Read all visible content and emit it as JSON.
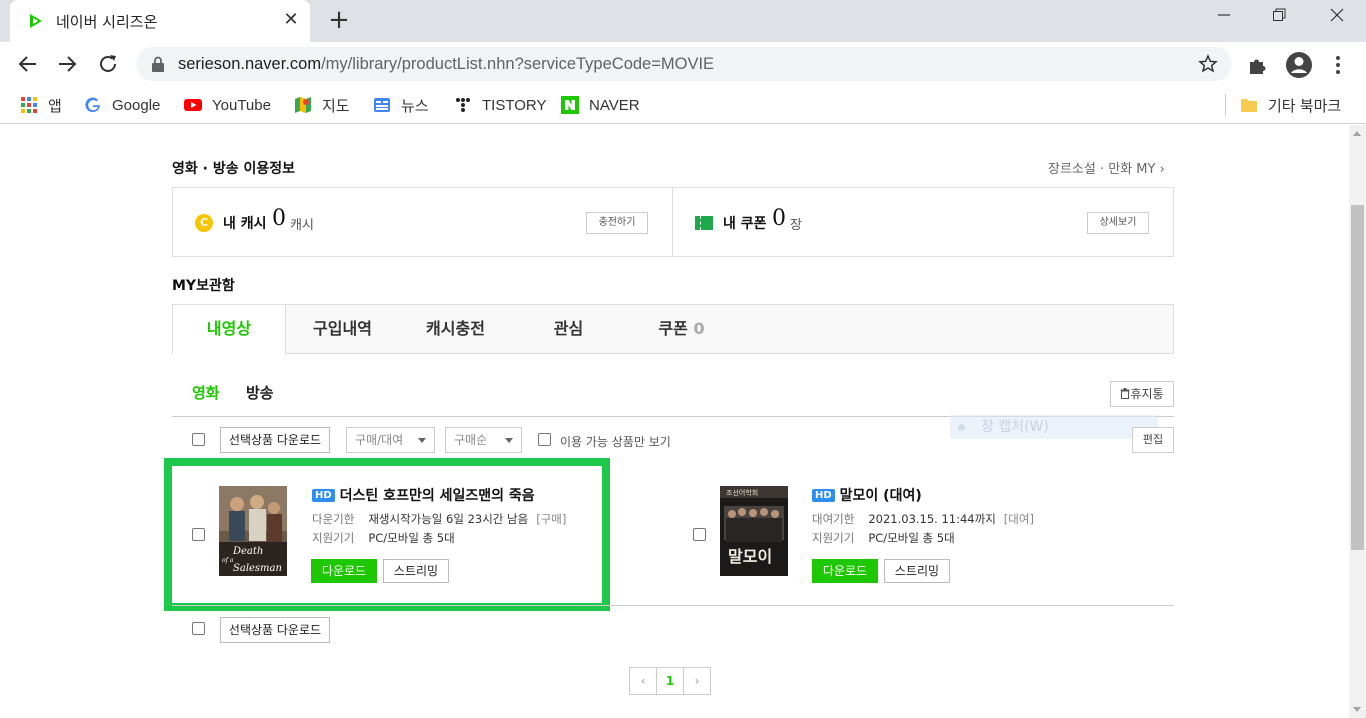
{
  "browser": {
    "tab_title": "네이버 시리즈온",
    "url_host": "serieson.naver.com",
    "url_path": "/my/library/productList.nhn?serviceTypeCode=MOVIE",
    "bookmarks": [
      {
        "label": "앱",
        "icon": "apps-grid-icon"
      },
      {
        "label": "Google",
        "icon": "google-icon"
      },
      {
        "label": "YouTube",
        "icon": "youtube-icon"
      },
      {
        "label": "지도",
        "icon": "maps-icon"
      },
      {
        "label": "뉴스",
        "icon": "news-icon"
      },
      {
        "label": "TISTORY",
        "icon": "tistory-icon"
      },
      {
        "label": "NAVER",
        "icon": "naver-icon"
      }
    ],
    "other_bookmarks": "기타 북마크"
  },
  "info": {
    "section_title": "영화 · 방송 이용정보",
    "genre_link": "장르소설 · 만화 MY",
    "cash_label": "내 캐시",
    "cash_count": "0",
    "cash_unit": "캐시",
    "cash_button": "충전하기",
    "cash_icon_letter": "C",
    "coupon_label": "내 쿠폰",
    "coupon_count": "0",
    "coupon_unit": "장",
    "coupon_button": "상세보기"
  },
  "library": {
    "title": "MY보관함",
    "tabs": [
      {
        "label": "내영상",
        "count": ""
      },
      {
        "label": "구입내역",
        "count": ""
      },
      {
        "label": "캐시충전",
        "count": ""
      },
      {
        "label": "관심",
        "count": ""
      },
      {
        "label": "쿠폰",
        "count": "0"
      }
    ],
    "sub_tabs": [
      "영화",
      "방송"
    ],
    "trash_button": "휴지통",
    "select_download": "선택상품 다운로드",
    "filter_type": "구매/대여",
    "sort_order": "구매순",
    "available_only": "이용 가능 상품만 보기",
    "edit_button": "편집",
    "capture_hint": "창 캡처(W)"
  },
  "items": [
    {
      "badge": "HD",
      "title": "더스틴 호프만의 세일즈맨의 죽음",
      "line1_key": "다운기한",
      "line1_value": "재생시작가능일 6일 23시간 남음",
      "line1_tag": "[구매]",
      "line2_key": "지원기기",
      "line2_value": "PC/모바일 총 5대",
      "download": "다운로드",
      "stream": "스트리밍",
      "poster_text": "Death of a Salesman"
    },
    {
      "badge": "HD",
      "title": "말모이 (대여)",
      "line1_key": "대여기한",
      "line1_value": "2021.03.15. 11:44까지",
      "line1_tag": "[대여]",
      "line2_key": "지원기기",
      "line2_value": "PC/모바일 총 5대",
      "download": "다운로드",
      "stream": "스트리밍",
      "poster_text": "말모이",
      "poster_top": "조선어학회"
    }
  ],
  "pagination": {
    "prev": "‹",
    "current": "1",
    "next": "›"
  },
  "colors": {
    "naver_green": "#1ec800",
    "highlight": "#1ec84a",
    "hd_blue": "#2d8ef0"
  }
}
